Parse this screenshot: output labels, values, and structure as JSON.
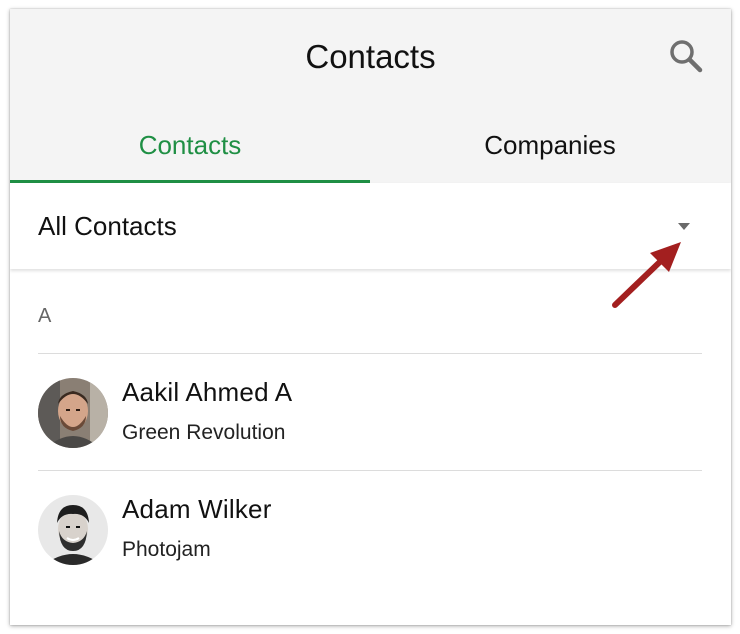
{
  "header": {
    "title": "Contacts"
  },
  "tabs": [
    {
      "label": "Contacts",
      "active": true
    },
    {
      "label": "Companies",
      "active": false
    }
  ],
  "filter": {
    "selected": "All Contacts"
  },
  "list": {
    "sections": [
      {
        "letter": "A",
        "contacts": [
          {
            "name": "Aakil Ahmed A",
            "company": "Green Revolution"
          },
          {
            "name": "Adam Wilker",
            "company": "Photojam"
          }
        ]
      }
    ]
  },
  "colors": {
    "accent": "#1f8f44",
    "header_background": "#f4f4f4",
    "annotation_arrow": "#a31f1f"
  },
  "icons": {
    "search": "search-icon",
    "dropdown": "caret-down-icon"
  }
}
